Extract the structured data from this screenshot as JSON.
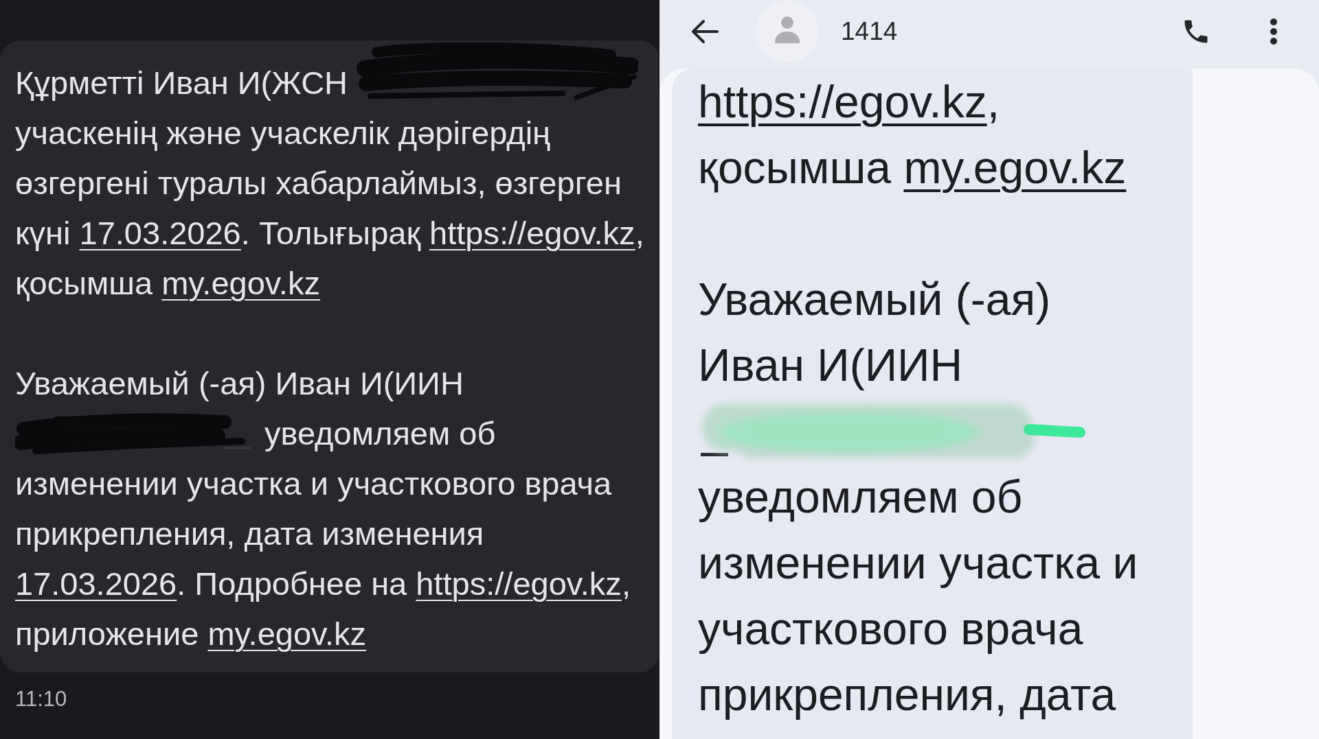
{
  "dark_view": {
    "message": {
      "paragraphs": [
        {
          "lines": [
            [
              {
                "kind": "text",
                "text": "Құрметті Иван И(ЖСН "
              },
              {
                "kind": "scribble"
              }
            ],
            [
              {
                "kind": "text",
                "text": "учаскенің және учаскелік дәрігердің"
              }
            ],
            [
              {
                "kind": "text",
                "text": "өзгергені туралы хабарлаймыз, өзгерген"
              }
            ],
            [
              {
                "kind": "text",
                "text": "күні "
              },
              {
                "kind": "date",
                "text": "17.03.2026"
              },
              {
                "kind": "text",
                "text": ". Толығырақ "
              },
              {
                "kind": "link",
                "text": "https://egov.kz"
              },
              {
                "kind": "text",
                "text": ","
              }
            ],
            [
              {
                "kind": "text",
                "text": "қосымша "
              },
              {
                "kind": "link",
                "text": "my.egov.kz"
              }
            ]
          ]
        },
        {
          "lines": [
            [
              {
                "kind": "text",
                "text": "Уважаемый (-ая) Иван И(ИИН"
              }
            ],
            [
              {
                "kind": "scribble"
              },
              {
                "kind": "text",
                "text": " уведомляем об"
              }
            ],
            [
              {
                "kind": "text",
                "text": "изменении участка и участкового врача"
              }
            ],
            [
              {
                "kind": "text",
                "text": "прикрепления, дата изменения"
              }
            ],
            [
              {
                "kind": "date",
                "text": "17.03.2026"
              },
              {
                "kind": "text",
                "text": ". Подробнее на "
              },
              {
                "kind": "link",
                "text": "https://egov.kz"
              },
              {
                "kind": "text",
                "text": ","
              }
            ],
            [
              {
                "kind": "text",
                "text": "приложение "
              },
              {
                "kind": "link",
                "text": "my.egov.kz"
              }
            ]
          ]
        }
      ]
    },
    "time": "11:10"
  },
  "light_view": {
    "header": {
      "title": "1414"
    },
    "message": {
      "paragraphs": [
        {
          "lines": [
            [
              {
                "kind": "link",
                "text": "https://egov.kz"
              },
              {
                "kind": "text",
                "text": ","
              }
            ],
            [
              {
                "kind": "text",
                "text": "қосымша "
              },
              {
                "kind": "link",
                "text": "my.egov.kz"
              }
            ]
          ]
        },
        {
          "lines": [
            [
              {
                "kind": "text",
                "text": "Уважаемый (-ая)"
              }
            ],
            [
              {
                "kind": "text",
                "text": "Иван И(ИИН"
              }
            ],
            [
              {
                "kind": "blur"
              }
            ],
            [
              {
                "kind": "text",
                "text": "уведомляем об"
              }
            ],
            [
              {
                "kind": "text",
                "text": "изменении участка и"
              }
            ],
            [
              {
                "kind": "text",
                "text": "участкового врача"
              }
            ],
            [
              {
                "kind": "text",
                "text": "прикрепления, дата"
              }
            ]
          ]
        }
      ]
    }
  }
}
